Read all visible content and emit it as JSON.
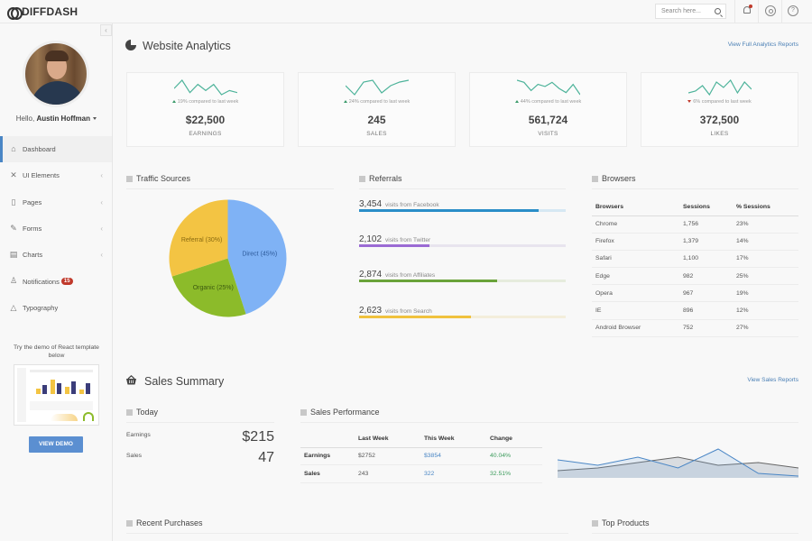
{
  "topbar": {
    "brand": "DIFFDASH",
    "search_placeholder": "Search here...",
    "icons": [
      "bell-icon",
      "gear-icon",
      "help-icon"
    ],
    "notification_dot_color": "#c0392b"
  },
  "sidebar": {
    "user_greeting": "Hello,",
    "user_name": "Austin Hoffman",
    "items": [
      {
        "label": "Dashboard",
        "icon": "home-icon",
        "active": true
      },
      {
        "label": "UI Elements",
        "icon": "tools-icon",
        "has_submenu": true
      },
      {
        "label": "Pages",
        "icon": "page-icon",
        "has_submenu": true
      },
      {
        "label": "Forms",
        "icon": "pencil-icon",
        "has_submenu": true
      },
      {
        "label": "Charts",
        "icon": "chart-icon",
        "has_submenu": true
      },
      {
        "label": "Notifications",
        "icon": "bell-icon",
        "badge": "15"
      },
      {
        "label": "Typography",
        "icon": "typography-icon"
      }
    ],
    "promo_text": "Try the demo of React template below",
    "demo_button": "VIEW DEMO"
  },
  "analytics": {
    "title": "Website Analytics",
    "link": "View Full Analytics Reports",
    "cards": [
      {
        "value": "$22,500",
        "label": "EARNINGS",
        "compare": "19% compared to last week",
        "trend": "up",
        "spark": [
          4,
          8,
          2,
          6,
          3,
          6,
          1,
          3,
          2
        ]
      },
      {
        "value": "245",
        "label": "SALES",
        "compare": "24% compared to last week",
        "trend": "up",
        "spark": [
          6,
          1,
          8,
          9,
          2,
          6,
          8,
          9
        ]
      },
      {
        "value": "561,724",
        "label": "VISITS",
        "compare": "44% compared to last week",
        "trend": "up",
        "spark": [
          9,
          8,
          4,
          7,
          6,
          8,
          5,
          3,
          7,
          2
        ]
      },
      {
        "value": "372,500",
        "label": "LIKES",
        "compare": "6% compared to last week",
        "trend": "down",
        "spark": [
          2,
          3,
          6,
          1,
          8,
          5,
          9,
          2,
          8,
          4
        ]
      }
    ],
    "up_color": "#3a9a6a",
    "down_color": "#c0392b"
  },
  "traffic": {
    "title": "Traffic Sources"
  },
  "chart_data": {
    "type": "pie",
    "title": "Traffic Sources",
    "slices": [
      {
        "label": "Direct (45%)",
        "value": 45,
        "color": "#7fb2f5"
      },
      {
        "label": "Organic (25%)",
        "value": 25,
        "color": "#8cbb2a"
      },
      {
        "label": "Referral (30%)",
        "value": 30,
        "color": "#f3c443"
      }
    ]
  },
  "referrals": {
    "title": "Referrals",
    "items": [
      {
        "count": "3,454",
        "text": "visits from Facebook",
        "fraction": 0.87,
        "color": "#2a8ec8",
        "track": "#d6e8f3"
      },
      {
        "count": "2,102",
        "text": "visits from Twitter",
        "fraction": 0.34,
        "color": "#9b6bd4",
        "track": "#e8e4ee"
      },
      {
        "count": "2,874",
        "text": "visits from Affiliates",
        "fraction": 0.67,
        "color": "#6aa33a",
        "track": "#e6ecdd"
      },
      {
        "count": "2,623",
        "text": "visits from Search",
        "fraction": 0.54,
        "color": "#f0c23e",
        "track": "#f3eedb"
      }
    ]
  },
  "browsers": {
    "title": "Browsers",
    "columns": [
      "Browsers",
      "Sessions",
      "% Sessions"
    ],
    "rows": [
      [
        "Chrome",
        "1,756",
        "23%"
      ],
      [
        "Firefox",
        "1,379",
        "14%"
      ],
      [
        "Safari",
        "1,100",
        "17%"
      ],
      [
        "Edge",
        "982",
        "25%"
      ],
      [
        "Opera",
        "967",
        "19%"
      ],
      [
        "IE",
        "896",
        "12%"
      ],
      [
        "Android Browser",
        "752",
        "27%"
      ]
    ]
  },
  "sales": {
    "title": "Sales Summary",
    "link": "View Sales Reports",
    "today": {
      "title": "Today",
      "earnings_label": "Earnings",
      "earnings_value": "$215",
      "sales_label": "Sales",
      "sales_value": "47"
    },
    "performance": {
      "title": "Sales Performance",
      "columns": [
        "",
        "Last Week",
        "This Week",
        "Change"
      ],
      "rows": [
        [
          "Earnings",
          "$2752",
          "$3854",
          "40.04%"
        ],
        [
          "Sales",
          "243",
          "322",
          "32.51%"
        ]
      ],
      "series_this_week": [
        6,
        4,
        7,
        3,
        10,
        1,
        0
      ],
      "series_last_week": [
        2,
        3,
        5,
        7,
        4,
        5,
        3
      ]
    }
  },
  "bottom": {
    "recent_purchases": "Recent Purchases",
    "top_products": "Top Products"
  }
}
